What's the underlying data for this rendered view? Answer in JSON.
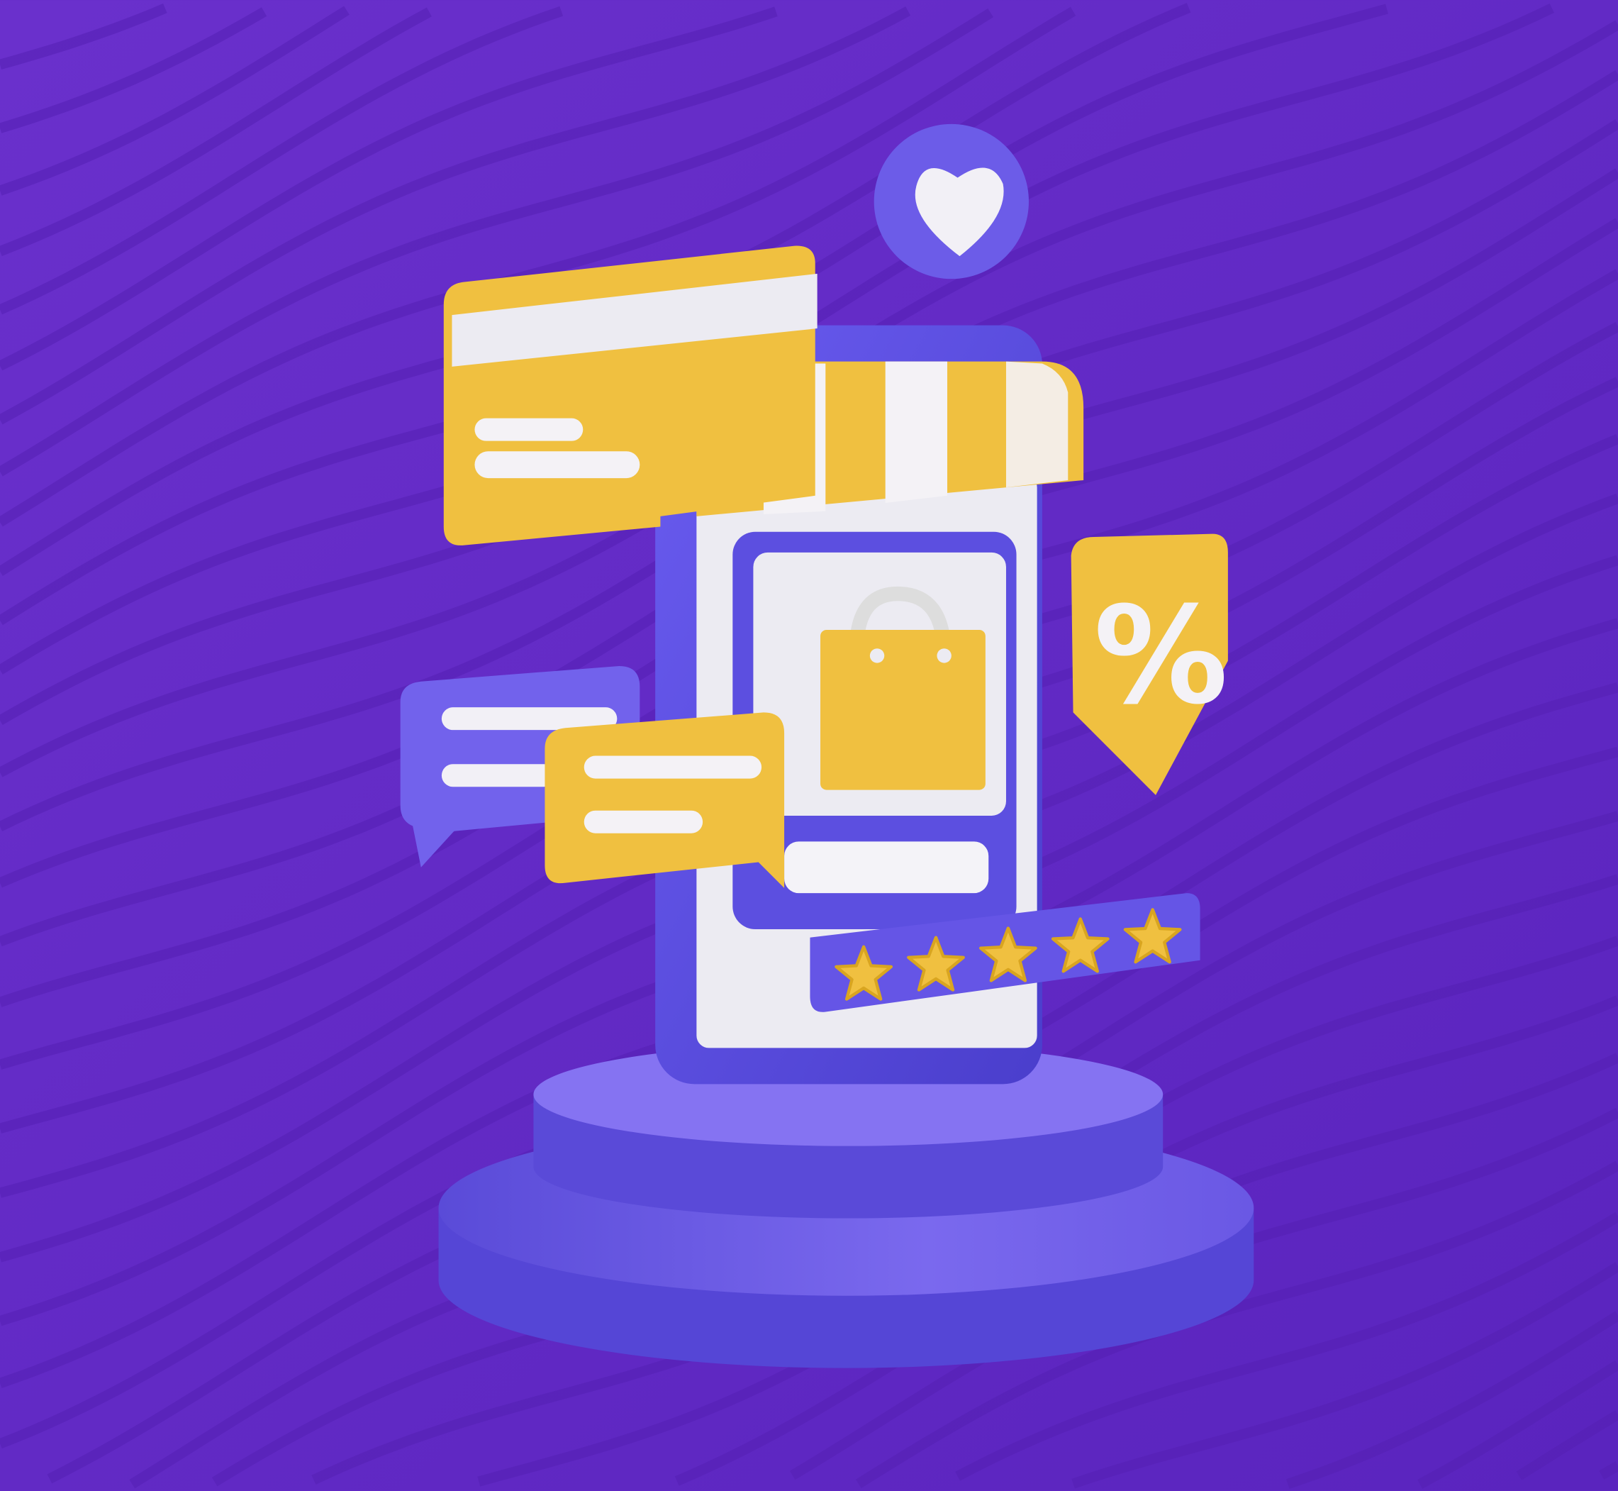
{
  "colors": {
    "background": "#6229c6",
    "phone": "#5b4fe0",
    "accent_yellow": "#f0c040",
    "screen_white": "#ecebf2",
    "podium": "#7363ea"
  },
  "icons": {
    "favorite": "heart-icon",
    "bag": "shopping-bag-icon",
    "discount": "percent-shield-icon",
    "card": "credit-card-icon",
    "chat": "chat-bubble-icon"
  },
  "discount_badge": {
    "text": "%"
  },
  "rating": {
    "value": 5,
    "max": 5
  }
}
